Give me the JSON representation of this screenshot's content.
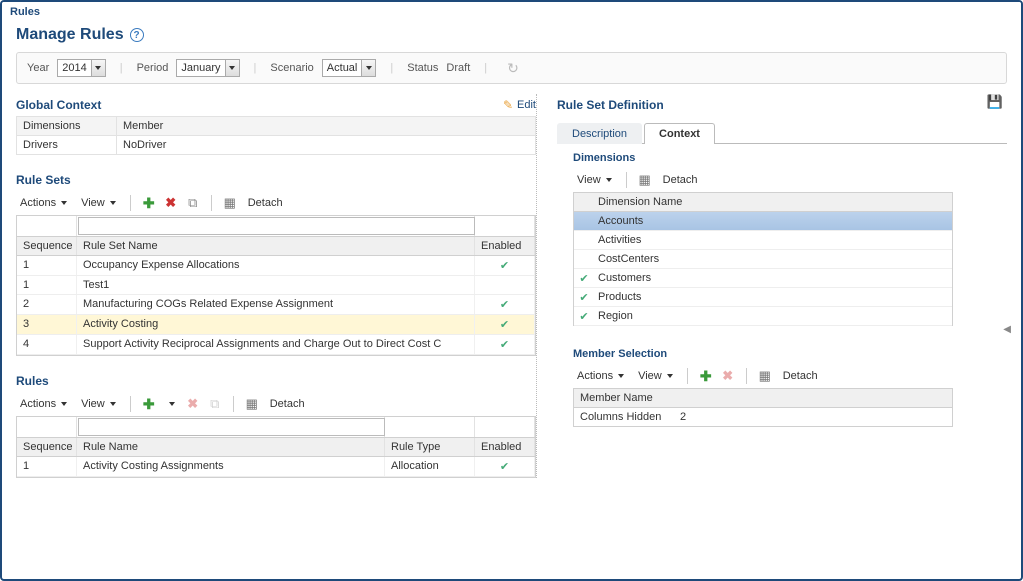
{
  "window_title": "Rules",
  "page_title": "Manage Rules",
  "filters": {
    "year_label": "Year",
    "year_value": "2014",
    "period_label": "Period",
    "period_value": "January",
    "scenario_label": "Scenario",
    "scenario_value": "Actual",
    "status_label": "Status",
    "status_value": "Draft"
  },
  "global_context": {
    "title": "Global Context",
    "edit_label": "Edit",
    "col_dimensions": "Dimensions",
    "col_member": "Member",
    "rows": [
      {
        "dim": "Drivers",
        "member": "NoDriver"
      }
    ]
  },
  "rule_sets": {
    "title": "Rule Sets",
    "actions_label": "Actions",
    "view_label": "View",
    "detach_label": "Detach",
    "col_sequence": "Sequence",
    "col_name": "Rule Set Name",
    "col_enabled": "Enabled",
    "rows": [
      {
        "seq": "1",
        "name": "Occupancy Expense Allocations",
        "enabled": true
      },
      {
        "seq": "1",
        "name": "Test1",
        "enabled": false
      },
      {
        "seq": "2",
        "name": "Manufacturing COGs Related Expense Assignment",
        "enabled": true
      },
      {
        "seq": "3",
        "name": "Activity Costing",
        "enabled": true,
        "selected": true
      },
      {
        "seq": "4",
        "name": "Support Activity Reciprocal Assignments and Charge Out to Direct Cost C",
        "enabled": true
      }
    ]
  },
  "rules": {
    "title": "Rules",
    "actions_label": "Actions",
    "view_label": "View",
    "detach_label": "Detach",
    "col_sequence": "Sequence",
    "col_name": "Rule Name",
    "col_type": "Rule Type",
    "col_enabled": "Enabled",
    "rows": [
      {
        "seq": "1",
        "name": "Activity Costing Assignments",
        "type": "Allocation",
        "enabled": true
      }
    ]
  },
  "definition": {
    "title": "Rule Set Definition",
    "tab_description": "Description",
    "tab_context": "Context",
    "dimensions_title": "Dimensions",
    "view_label": "View",
    "detach_label": "Detach",
    "col_dimension_name": "Dimension Name",
    "dims": [
      {
        "name": "Accounts",
        "checked": false,
        "highlight": true
      },
      {
        "name": "Activities",
        "checked": false
      },
      {
        "name": "CostCenters",
        "checked": false
      },
      {
        "name": "Customers",
        "checked": true
      },
      {
        "name": "Products",
        "checked": true
      },
      {
        "name": "Region",
        "checked": true
      }
    ],
    "member_selection_title": "Member Selection",
    "ms_actions_label": "Actions",
    "ms_view_label": "View",
    "ms_detach_label": "Detach",
    "ms_col_member_name": "Member Name",
    "ms_columns_hidden_label": "Columns Hidden",
    "ms_columns_hidden_value": "2"
  }
}
